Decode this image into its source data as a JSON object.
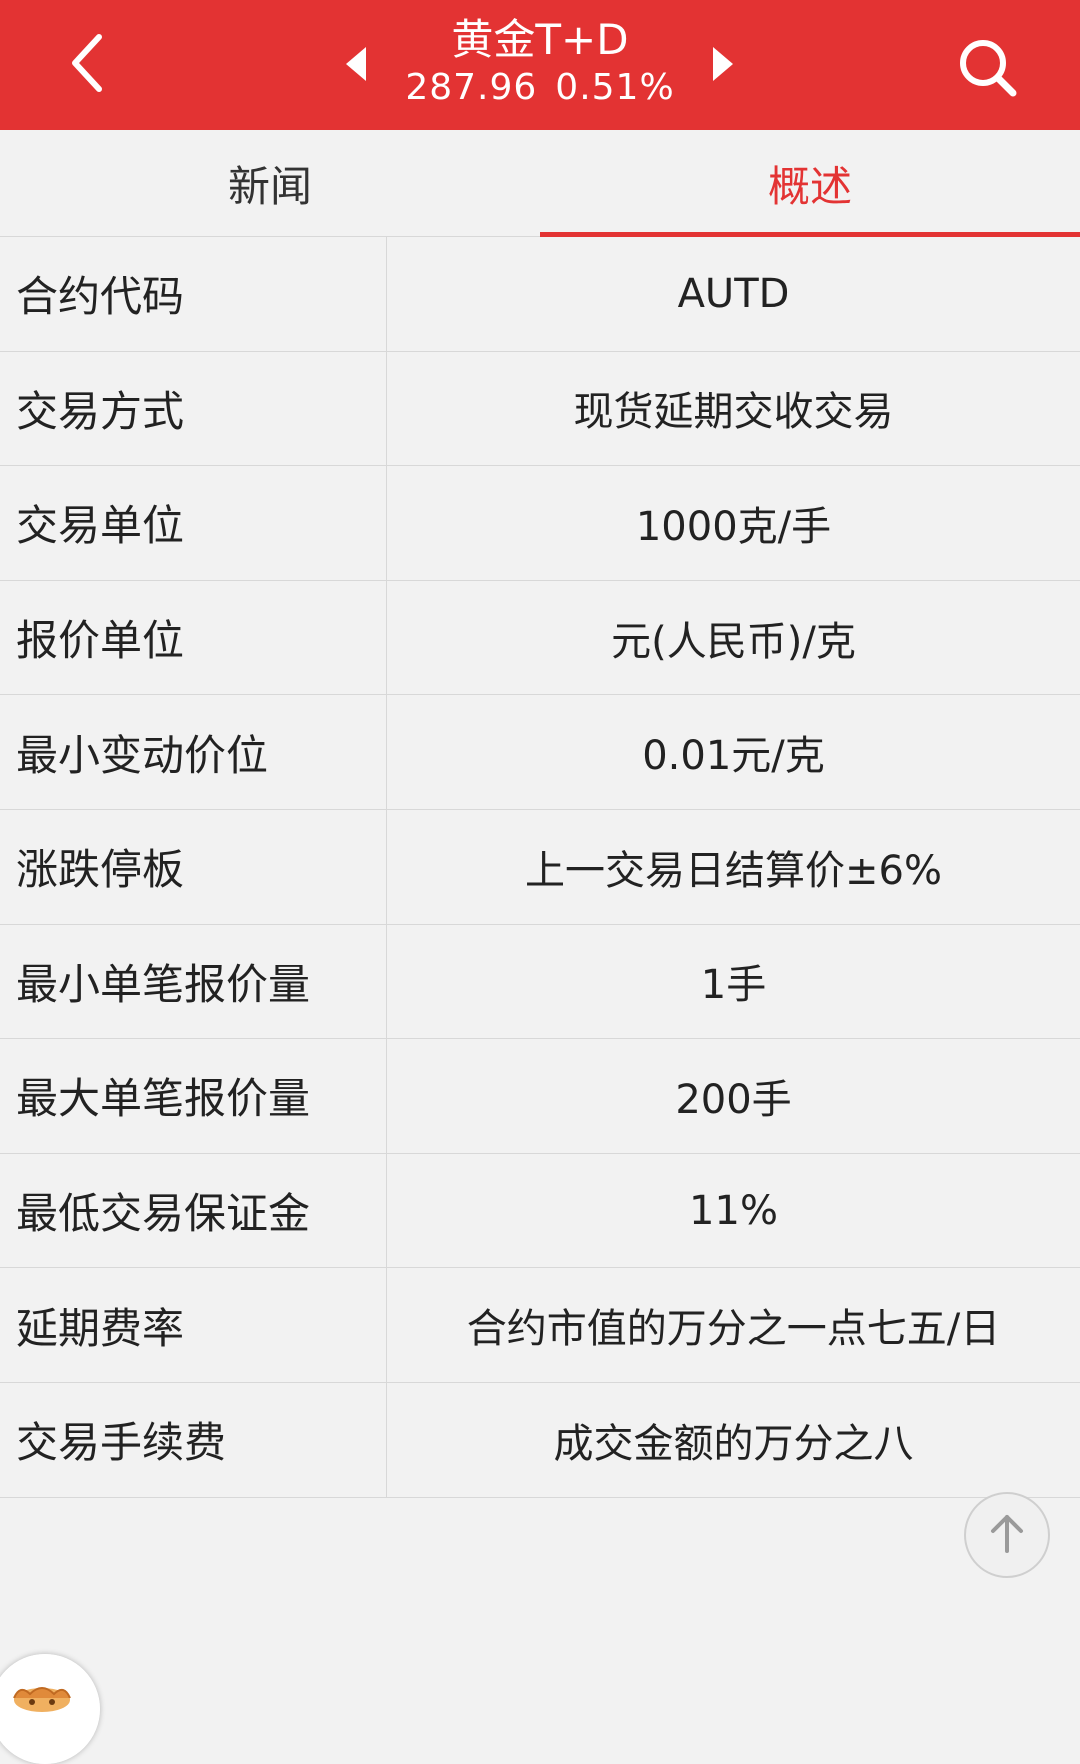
{
  "header": {
    "name": "黄金T+D",
    "price": "287.96",
    "change": "0.51%"
  },
  "tabs": [
    {
      "label": "新闻"
    },
    {
      "label": "概述"
    }
  ],
  "overview": {
    "rows": [
      {
        "label": "合约代码",
        "value": "AUTD"
      },
      {
        "label": "交易方式",
        "value": "现货延期交收交易"
      },
      {
        "label": "交易单位",
        "value": "1000克/手"
      },
      {
        "label": "报价单位",
        "value": "元(人民币)/克"
      },
      {
        "label": "最小变动价位",
        "value": "0.01元/克"
      },
      {
        "label": "涨跌停板",
        "value": "上一交易日结算价±6%"
      },
      {
        "label": "最小单笔报价量",
        "value": "1手"
      },
      {
        "label": "最大单笔报价量",
        "value": "200手"
      },
      {
        "label": "最低交易保证金",
        "value": "11%"
      },
      {
        "label": "延期费率",
        "value": "合约市值的万分之一点七五/日"
      },
      {
        "label": "交易手续费",
        "value": "成交金额的万分之八"
      }
    ]
  },
  "icons": {
    "back": "chevron-left-icon",
    "prev": "triangle-left-icon",
    "next": "triangle-right-icon",
    "search": "search-icon",
    "scroll_top": "arrow-up-icon",
    "avatar": "mascot-avatar-icon"
  },
  "colors": {
    "accent": "#e33333",
    "background": "#f2f2f2",
    "divider": "#d8d8d8"
  }
}
